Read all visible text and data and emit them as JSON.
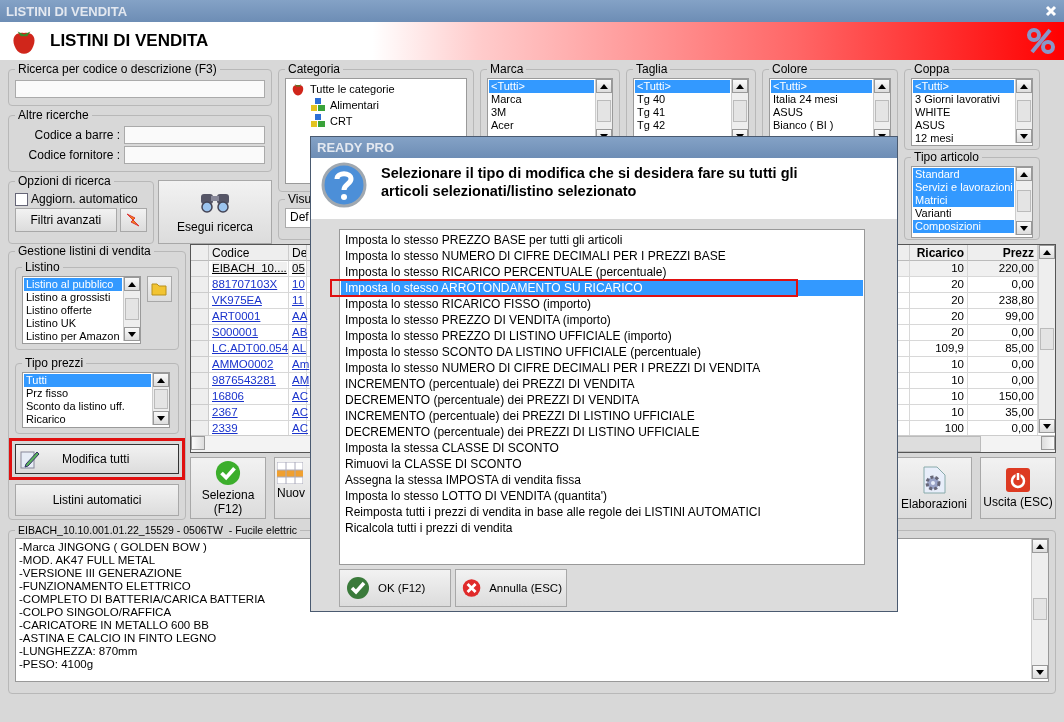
{
  "window": {
    "title": "LISTINI DI VENDITA"
  },
  "header": {
    "title": "LISTINI DI VENDITA"
  },
  "search": {
    "label": "Ricerca per codice o descrizione (F3)"
  },
  "other_searches": {
    "label": "Altre ricerche",
    "fields": [
      {
        "label": "Codice a barre :"
      },
      {
        "label": "Codice fornitore :"
      }
    ]
  },
  "search_options": {
    "label": "Opzioni di ricerca",
    "auto_update": {
      "label": "Aggiorn. automatico",
      "checked": false
    },
    "advanced_button": "Filtri avanzati"
  },
  "run_search_button": "Esegui ricerca",
  "category": {
    "label": "Categoria",
    "root": "Tutte le categorie",
    "children": [
      "Alimentari",
      "CRT"
    ]
  },
  "filters": [
    {
      "label": "Marca",
      "items": [
        {
          "label": "<Tutti>",
          "selected": true
        },
        {
          "label": "Marca",
          "selected": false
        },
        {
          "label": "3M",
          "selected": false
        },
        {
          "label": "Acer",
          "selected": false
        }
      ]
    },
    {
      "label": "Taglia",
      "items": [
        {
          "label": "<Tutti>",
          "selected": true
        },
        {
          "label": "Tg 40",
          "selected": false
        },
        {
          "label": "Tg 41",
          "selected": false
        },
        {
          "label": "Tg 42",
          "selected": false
        }
      ]
    },
    {
      "label": "Colore",
      "items": [
        {
          "label": "<Tutti>",
          "selected": true
        },
        {
          "label": "Italia 24 mesi",
          "selected": false
        },
        {
          "label": "ASUS",
          "selected": false
        },
        {
          "label": "Bianco ( BI )",
          "selected": false
        }
      ]
    },
    {
      "label": "Coppa",
      "items": [
        {
          "label": "<Tutti>",
          "selected": true
        },
        {
          "label": "3 Giorni lavorativi",
          "selected": false
        },
        {
          "label": "WHITE",
          "selected": false
        },
        {
          "label": "ASUS",
          "selected": false
        },
        {
          "label": "12 mesi",
          "selected": false
        }
      ]
    }
  ],
  "view": {
    "label": "Visu",
    "value": "Def"
  },
  "article_type": {
    "label": "Tipo articolo",
    "items": [
      {
        "label": "Standard",
        "selected": true
      },
      {
        "label": "Servizi e lavorazioni",
        "selected": true
      },
      {
        "label": "Matrici",
        "selected": true
      },
      {
        "label": "Varianti",
        "selected": false
      },
      {
        "label": "Composizioni",
        "selected": true
      }
    ]
  },
  "price_lists": {
    "label": "Gestione listini di vendita",
    "list_label": "Listino",
    "items": [
      {
        "label": "Listino al pubblico",
        "selected": true
      },
      {
        "label": "Listino a grossisti",
        "selected": false
      },
      {
        "label": "Listino offerte",
        "selected": false
      },
      {
        "label": "Listino UK",
        "selected": false
      },
      {
        "label": "Listino per Amazon",
        "selected": false
      }
    ],
    "price_type_label": "Tipo prezzi",
    "price_types": [
      {
        "label": "Tutti",
        "selected": true
      },
      {
        "label": "Prz fisso",
        "selected": false
      },
      {
        "label": "Sconto da listino uff.",
        "selected": false
      },
      {
        "label": "Ricarico",
        "selected": false
      }
    ],
    "edit_all_button": "Modifica tutti",
    "edit_all_highlighted": true,
    "auto_lists_button": "Listini automatici"
  },
  "table": {
    "columns": [
      "Codice",
      "De",
      "Ricarico",
      "Prezz"
    ],
    "rows": [
      {
        "cells": [
          "EIBACH_10....",
          "05",
          "10",
          "220,00"
        ],
        "current": true
      },
      {
        "cells": [
          "881707103X",
          "10",
          "20",
          "0,00"
        ],
        "current": false
      },
      {
        "cells": [
          "VK975EA",
          "11",
          "20",
          "238,80"
        ],
        "current": false
      },
      {
        "cells": [
          "ART0001",
          "AA",
          "20",
          "99,00"
        ],
        "current": false
      },
      {
        "cells": [
          "S000001",
          "AB",
          "20",
          "0,00"
        ],
        "current": false
      },
      {
        "cells": [
          "LC.ADT00.054",
          "AL",
          "109,9",
          "85,00"
        ],
        "current": false
      },
      {
        "cells": [
          "AMMO0002",
          "Am",
          "10",
          "0,00"
        ],
        "current": false
      },
      {
        "cells": [
          "9876543281",
          "AM",
          "10",
          "0,00"
        ],
        "current": false
      },
      {
        "cells": [
          "16806",
          "AC",
          "10",
          "150,00"
        ],
        "current": false
      },
      {
        "cells": [
          "2367",
          "AC",
          "10",
          "35,00"
        ],
        "current": false
      },
      {
        "cells": [
          "2339",
          "AC",
          "100",
          "0,00"
        ],
        "current": false
      }
    ]
  },
  "actions": [
    {
      "label": "Seleziona (F12)",
      "kind": "select"
    },
    {
      "label": "Nuov",
      "kind": "new"
    },
    {
      "label": "Elaborazioni",
      "kind": "process"
    },
    {
      "label": "Uscita (ESC)",
      "kind": "exit"
    }
  ],
  "description": {
    "title": "EIBACH_10.10.001.01.22_15529 - 0506TW  - Fucile elettric",
    "lines": [
      "-Marca JINGONG ( GOLDEN BOW )",
      "-MOD. AK47 FULL METAL",
      "-VERSIONE III GENERAZIONE",
      "-FUNZIONAMENTO ELETTRICO",
      "-COMPLETO DI BATTERIA/CARICA BATTERIA",
      "-COLPO SINGOLO/RAFFICA",
      "-CARICATORE IN METALLO 600 BB",
      "-ASTINA E CALCIO IN FINTO LEGNO",
      "-LUNGHEZZA: 870mm",
      "-PESO: 4100g"
    ]
  },
  "dialog": {
    "title": "READY PRO",
    "message": "Selezionare il tipo di modifica che si desidera fare su tutti gli articoli selezionati/listino selezionato",
    "options": [
      {
        "label": "Imposta lo stesso PREZZO BASE per tutti gli articoli",
        "selected": false,
        "highlighted": false
      },
      {
        "label": "Imposta lo stesso NUMERO DI CIFRE DECIMALI PER I PREZZI BASE",
        "selected": false,
        "highlighted": false
      },
      {
        "label": "Imposta lo stesso RICARICO PERCENTUALE (percentuale)",
        "selected": false,
        "highlighted": false
      },
      {
        "label": "Imposta lo stesso ARROTONDAMENTO SU RICARICO",
        "selected": true,
        "highlighted": true
      },
      {
        "label": "Imposta lo stesso RICARICO FISSO (importo)",
        "selected": false,
        "highlighted": false
      },
      {
        "label": "Imposta lo stesso PREZZO DI VENDITA (importo)",
        "selected": false,
        "highlighted": false
      },
      {
        "label": "Imposta lo stesso PREZZO DI LISTINO UFFICIALE (importo)",
        "selected": false,
        "highlighted": false
      },
      {
        "label": "Imposta lo stesso SCONTO DA LISTINO UFFICIALE (percentuale)",
        "selected": false,
        "highlighted": false
      },
      {
        "label": "Imposta lo stesso NUMERO DI CIFRE DECIMALI PER I PREZZI DI VENDITA",
        "selected": false,
        "highlighted": false
      },
      {
        "label": "INCREMENTO (percentuale) dei PREZZI DI VENDITA",
        "selected": false,
        "highlighted": false
      },
      {
        "label": "DECREMENTO (percentuale) dei PREZZI DI VENDITA",
        "selected": false,
        "highlighted": false
      },
      {
        "label": "INCREMENTO (percentuale) dei PREZZI DI LISTINO UFFICIALE",
        "selected": false,
        "highlighted": false
      },
      {
        "label": "DECREMENTO (percentuale) dei PREZZI DI LISTINO UFFICIALE",
        "selected": false,
        "highlighted": false
      },
      {
        "label": "Imposta la stessa CLASSE DI SCONTO",
        "selected": false,
        "highlighted": false
      },
      {
        "label": "Rimuovi la CLASSE DI SCONTO",
        "selected": false,
        "highlighted": false
      },
      {
        "label": "Assegna la stessa IMPOSTA di vendita fissa",
        "selected": false,
        "highlighted": false
      },
      {
        "label": "Imposta lo stesso LOTTO DI VENDITA (quantita')",
        "selected": false,
        "highlighted": false
      },
      {
        "label": "Reimposta tutti i prezzi di vendita in base alle regole dei LISTINI AUTOMATICI",
        "selected": false,
        "highlighted": false
      },
      {
        "label": "Ricalcola tutti i prezzi di vendita",
        "selected": false,
        "highlighted": false
      }
    ],
    "buttons": [
      {
        "label": "OK (F12)",
        "kind": "ok"
      },
      {
        "label": "Annulla (ESC)",
        "kind": "cancel"
      }
    ]
  }
}
